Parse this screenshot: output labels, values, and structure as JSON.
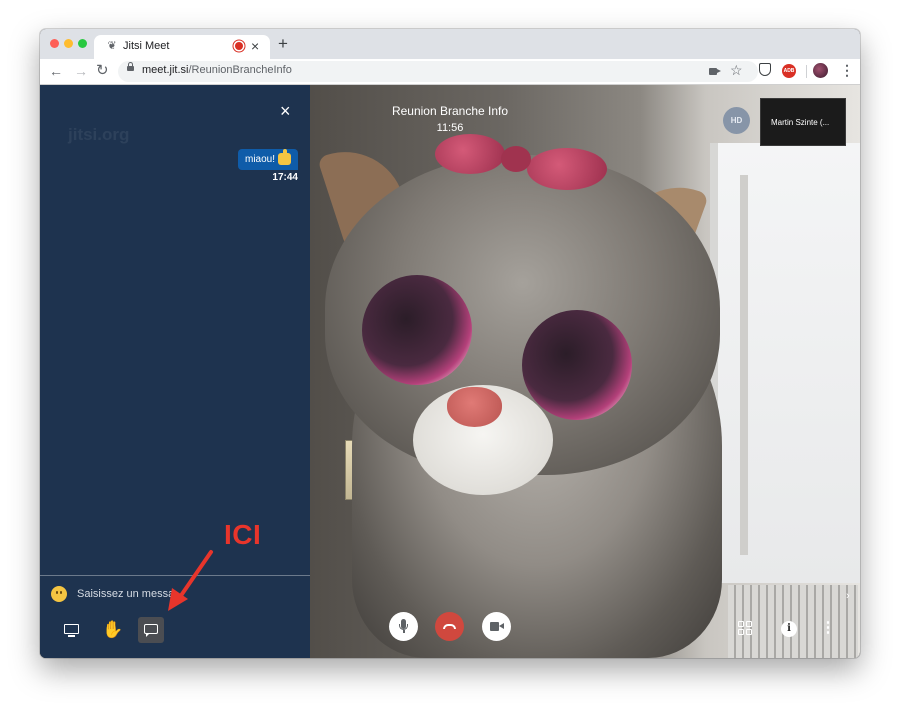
{
  "browser": {
    "tab_title": "Jitsi Meet",
    "tab_close": "×",
    "new_tab": "+",
    "url_host": "meet.jit.si",
    "url_path": "/ReunionBrancheInfo",
    "nav_back": "←",
    "nav_forward": "→",
    "nav_reload": "↻",
    "star": "☆",
    "menu": "⋮",
    "adblock_label": "ADB"
  },
  "sidebar": {
    "watermark": "jitsi.org",
    "close": "×",
    "message_text": "miaou!",
    "message_emoji": "thumbs-up",
    "message_time": "17:44",
    "input_placeholder": "Saisissez un message"
  },
  "conference": {
    "title": "Reunion Branche Info",
    "timer": "11:56",
    "quality_badge": "HD",
    "participant_name": "Martin Szinte (...",
    "filmstrip_toggle": "›"
  },
  "toolbar": {
    "raise_hand": "✋",
    "info": "i",
    "more": "⋮"
  },
  "annotation": {
    "label": "ICI",
    "color": "#e8352b"
  },
  "colors": {
    "sidebar_bg": "#1d3453",
    "message_bubble": "#0f5ca9",
    "hangup": "#d0483e"
  }
}
